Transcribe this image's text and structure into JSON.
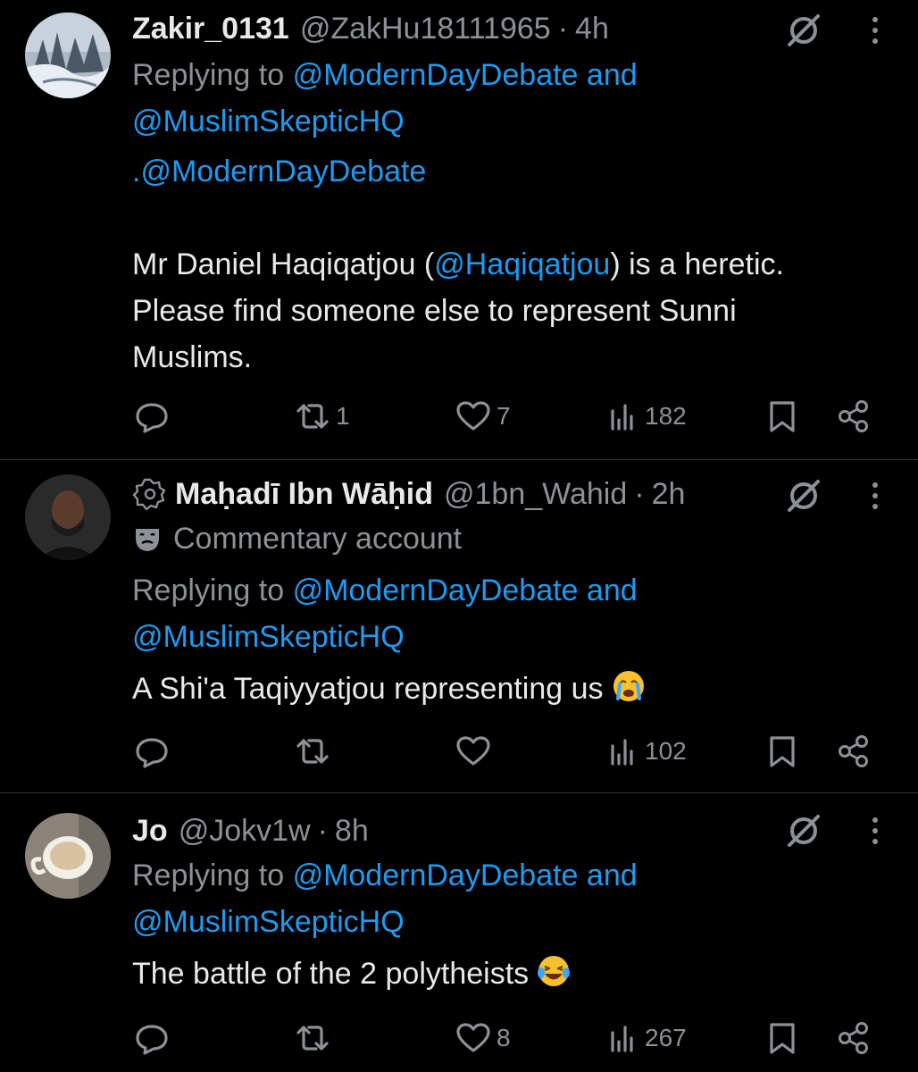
{
  "tweets": [
    {
      "name": "Zakir_0131",
      "handle": "@ZakHu18111965",
      "sep": "·",
      "time": "4h",
      "reply_prefix": "Replying to",
      "reply_to_1": "@ModernDayDebate",
      "reply_and": "and",
      "reply_to_2": "@MuslimSkepticHQ",
      "body_mention": ".@ModernDayDebate",
      "body_pre": "Mr Daniel Haqiqatjou (",
      "body_link": "@Haqiqatjou",
      "body_post": ") is a heretic.",
      "body_line2": "Please find someone else to represent Sunni",
      "body_line3": "Muslims.",
      "retweets": "1",
      "likes": "7",
      "views": "182"
    },
    {
      "name": "Maḥadī Ibn Wāḥid",
      "handle": "@1bn_Wahid",
      "sep": "·",
      "time": "2h",
      "label": "Commentary account",
      "reply_prefix": "Replying to",
      "reply_to_1": "@ModernDayDebate",
      "reply_and": "and",
      "reply_to_2": "@MuslimSkepticHQ",
      "body": "A Shi'a Taqiyyatjou representing us",
      "body_emoji": "crying-face-emoji",
      "retweets": "",
      "likes": "",
      "views": "102"
    },
    {
      "name": "Jo",
      "handle": "@Jokv1w",
      "sep": "·",
      "time": "8h",
      "reply_prefix": "Replying to",
      "reply_to_1": "@ModernDayDebate",
      "reply_and": "and",
      "reply_to_2": "@MuslimSkepticHQ",
      "body": "The battle of the 2 polytheists",
      "body_emoji": "laughing-face-emoji",
      "retweets": "",
      "likes": "8",
      "views": "267"
    }
  ],
  "colors": {
    "background": "#000000",
    "text": "#e7e9ea",
    "muted": "#8b9197",
    "link": "#1d9bf0",
    "separator": "#2f3336"
  },
  "icons": [
    "reply-icon",
    "retweet-icon",
    "like-icon",
    "views-icon",
    "bookmark-icon",
    "share-icon",
    "grok-icon",
    "more-icon",
    "automated-badge-icon",
    "commentary-mask-icon"
  ]
}
